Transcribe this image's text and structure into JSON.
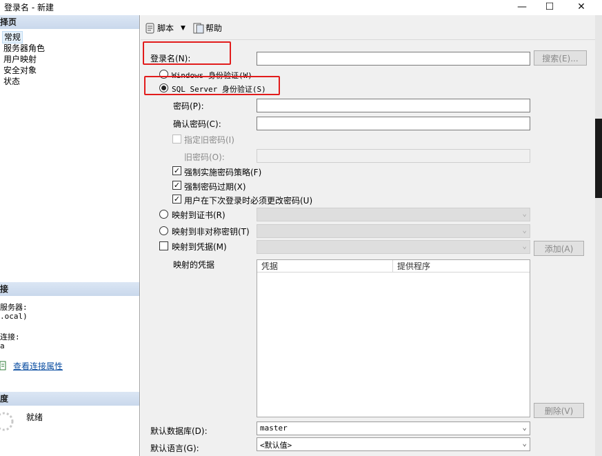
{
  "window": {
    "title": "登录名 - 新建"
  },
  "left": {
    "select_page_header": "择页",
    "nav": [
      "常规",
      "服务器角色",
      "用户映射",
      "安全对象",
      "状态"
    ],
    "connection_header": "接",
    "server_label": "服务器:",
    "server_value": ".ocal)",
    "connection_label": "连接:",
    "connection_value": "a",
    "view_props_link": "查看连接属性",
    "progress_header": "度",
    "progress_status": "就绪"
  },
  "toolbar": {
    "script_label": "脚本",
    "help_label": "帮助"
  },
  "form": {
    "login_name_label": "登录名(N):",
    "login_name_value": "",
    "search_button": "搜索(E)...",
    "windows_auth_label": "Windows 身份验证(W)",
    "sql_auth_label": "SQL Server 身份验证(S)",
    "password_label": "密码(P):",
    "confirm_password_label": "确认密码(C):",
    "specify_old_password_label": "指定旧密码(I)",
    "old_password_label": "旧密码(O):",
    "enforce_policy_label": "强制实施密码策略(F)",
    "enforce_expiration_label": "强制密码过期(X)",
    "must_change_label": "用户在下次登录时必须更改密码(U)",
    "map_cert_label": "映射到证书(R)",
    "map_asym_key_label": "映射到非对称密钥(T)",
    "map_credential_label": "映射到凭据(M)",
    "add_button": "添加(A)",
    "mapped_credentials_label": "映射的凭据",
    "grid_columns": [
      "凭据",
      "提供程序"
    ],
    "remove_button": "删除(V)",
    "default_db_label": "默认数据库(D):",
    "default_db_value": "master",
    "default_lang_label": "默认语言(G):",
    "default_lang_value": "<默认值>"
  },
  "colors": {
    "highlight_red": "#e21b1b",
    "link_blue": "#0b4ea2",
    "pane_bg": "#f0f0f0"
  }
}
